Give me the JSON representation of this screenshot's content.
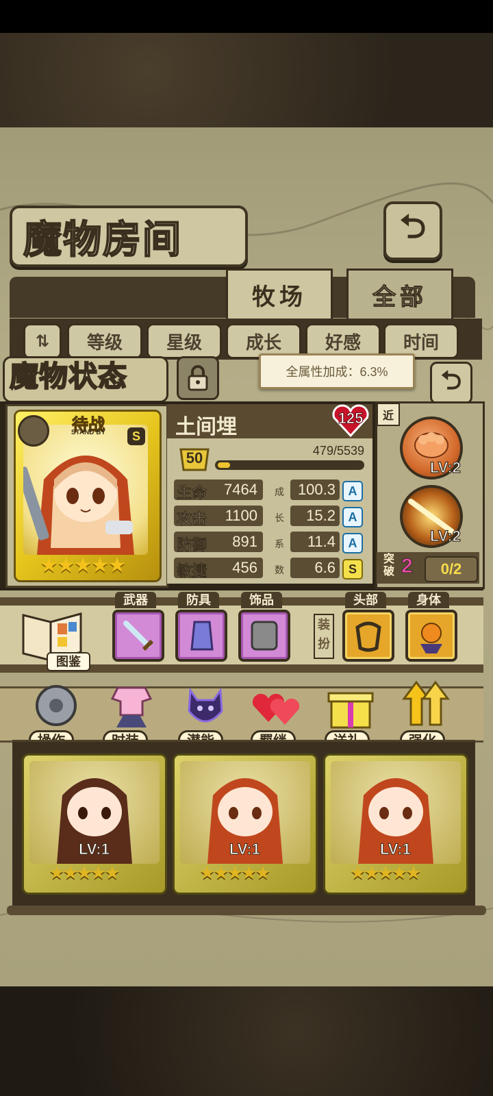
{
  "header": {
    "title": "魔物房间",
    "back_icon": "back-arrow-icon"
  },
  "tabs": [
    {
      "label": "牧场",
      "active": true
    },
    {
      "label": "全部",
      "active": false
    }
  ],
  "sort_buttons": [
    "等级",
    "星级",
    "成长",
    "好感",
    "时间"
  ],
  "panel": {
    "title": "魔物状态",
    "tooltip": "全属性加成：6.3%",
    "monster": {
      "name": "土间埋",
      "affection": "125",
      "level": "50",
      "exp": "479/5539",
      "exp_progress": 0.0865,
      "card_banner": "待战",
      "card_banner_sub": "STAND BY",
      "grade": "S",
      "stars": "★★★★★"
    },
    "stats": [
      {
        "label": "生命",
        "value": "7464",
        "growth": "100.3",
        "rank": "A"
      },
      {
        "label": "攻击",
        "value": "1100",
        "growth": "15.2",
        "rank": "A"
      },
      {
        "label": "防御",
        "value": "891",
        "growth": "11.4",
        "rank": "A"
      },
      {
        "label": "敏捷",
        "value": "456",
        "growth": "6.6",
        "rank": "S"
      }
    ],
    "growth_chars": [
      "成",
      "长",
      "系",
      "数"
    ],
    "range": "近",
    "skills": [
      {
        "lv": "LV:2"
      },
      {
        "lv": "LV:2"
      }
    ],
    "breakthrough": {
      "label": "突破",
      "count": "2",
      "progress": "0/2"
    }
  },
  "equipment": {
    "book_label": "图鉴",
    "slots": [
      "武器",
      "防具",
      "饰品"
    ],
    "dress_label": "装扮",
    "dress_slots": [
      "头部",
      "身体"
    ]
  },
  "actions": [
    "操作",
    "时装",
    "潜能",
    "羁绊",
    "送礼",
    "强化"
  ],
  "monster_grid": [
    {
      "lv": "LV:1",
      "stars": "★★★★★"
    },
    {
      "lv": "LV:1",
      "stars": "★★★★★"
    },
    {
      "lv": "LV:1",
      "stars": "★★★★★"
    }
  ],
  "colors": {
    "accent_gold": "#f0c230",
    "rank_blue": "#1b6ea4",
    "affection_red": "#c8142a",
    "breakthrough_pink": "#ec4ab0"
  }
}
